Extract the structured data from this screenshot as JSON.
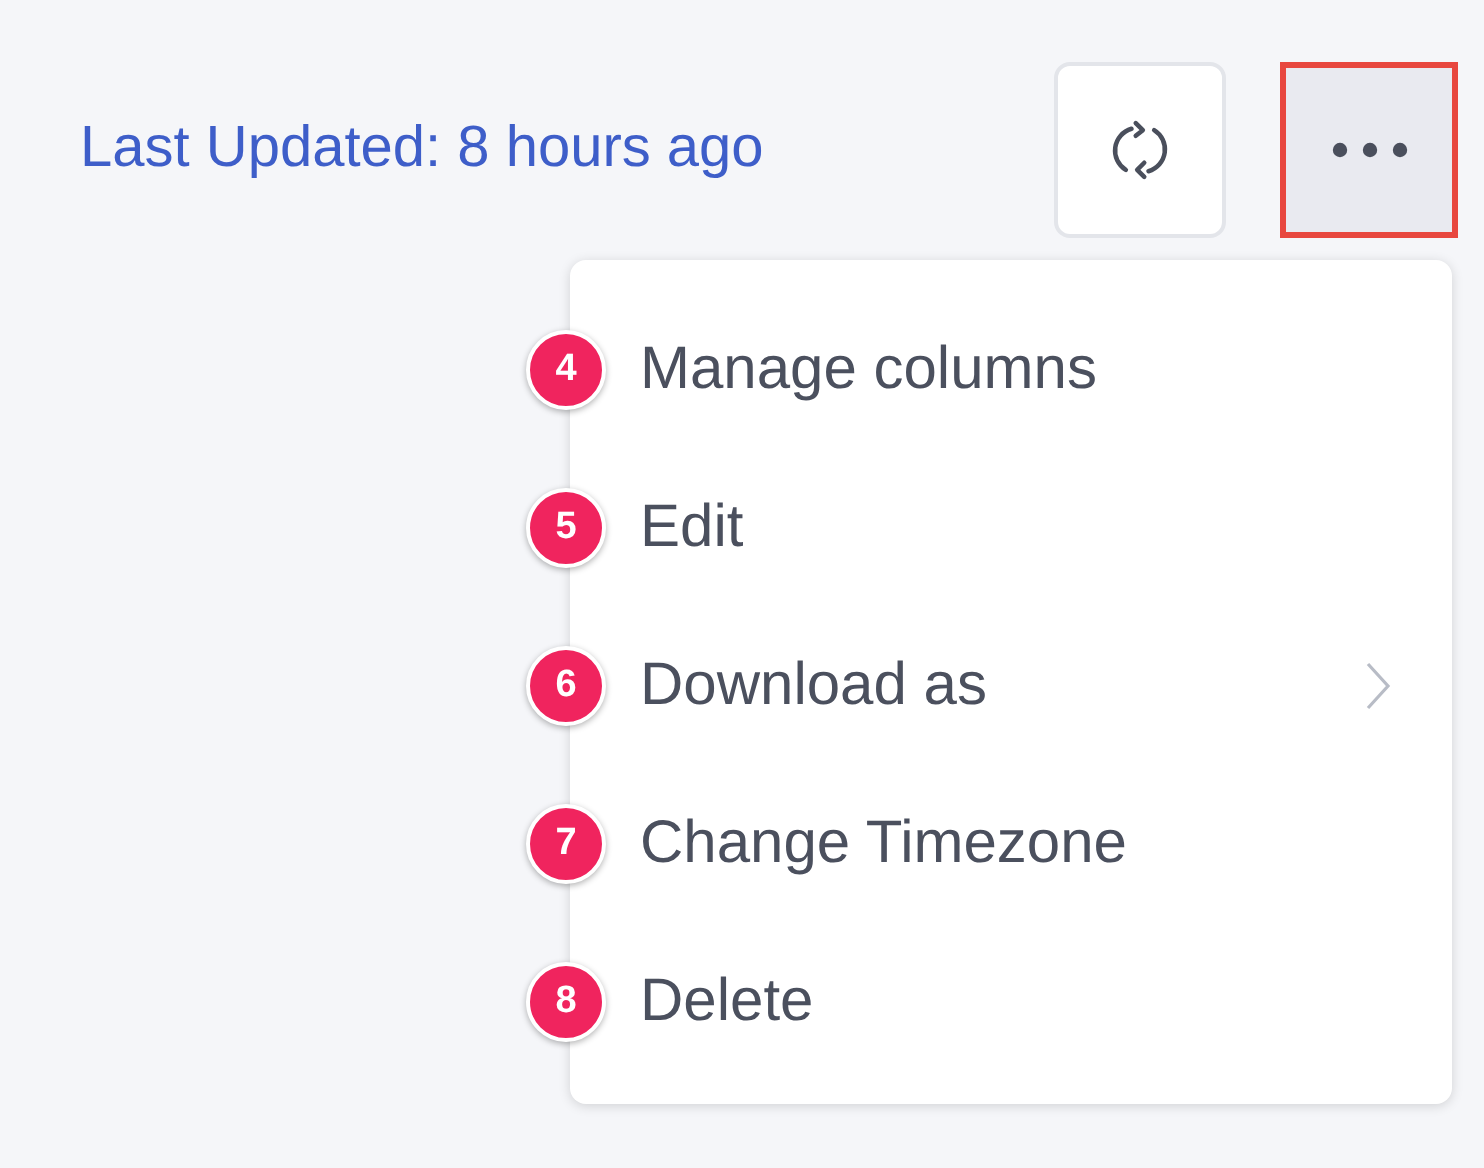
{
  "header": {
    "last_updated": "Last Updated: 8 hours ago",
    "more_button": {
      "highlighted": true
    }
  },
  "menu": {
    "items": [
      {
        "label": "Manage columns",
        "badge": "4",
        "submenu": false
      },
      {
        "label": "Edit",
        "badge": "5",
        "submenu": false
      },
      {
        "label": "Download as",
        "badge": "6",
        "submenu": true
      },
      {
        "label": "Change Timezone",
        "badge": "7",
        "submenu": false
      },
      {
        "label": "Delete",
        "badge": "8",
        "submenu": false
      }
    ]
  }
}
